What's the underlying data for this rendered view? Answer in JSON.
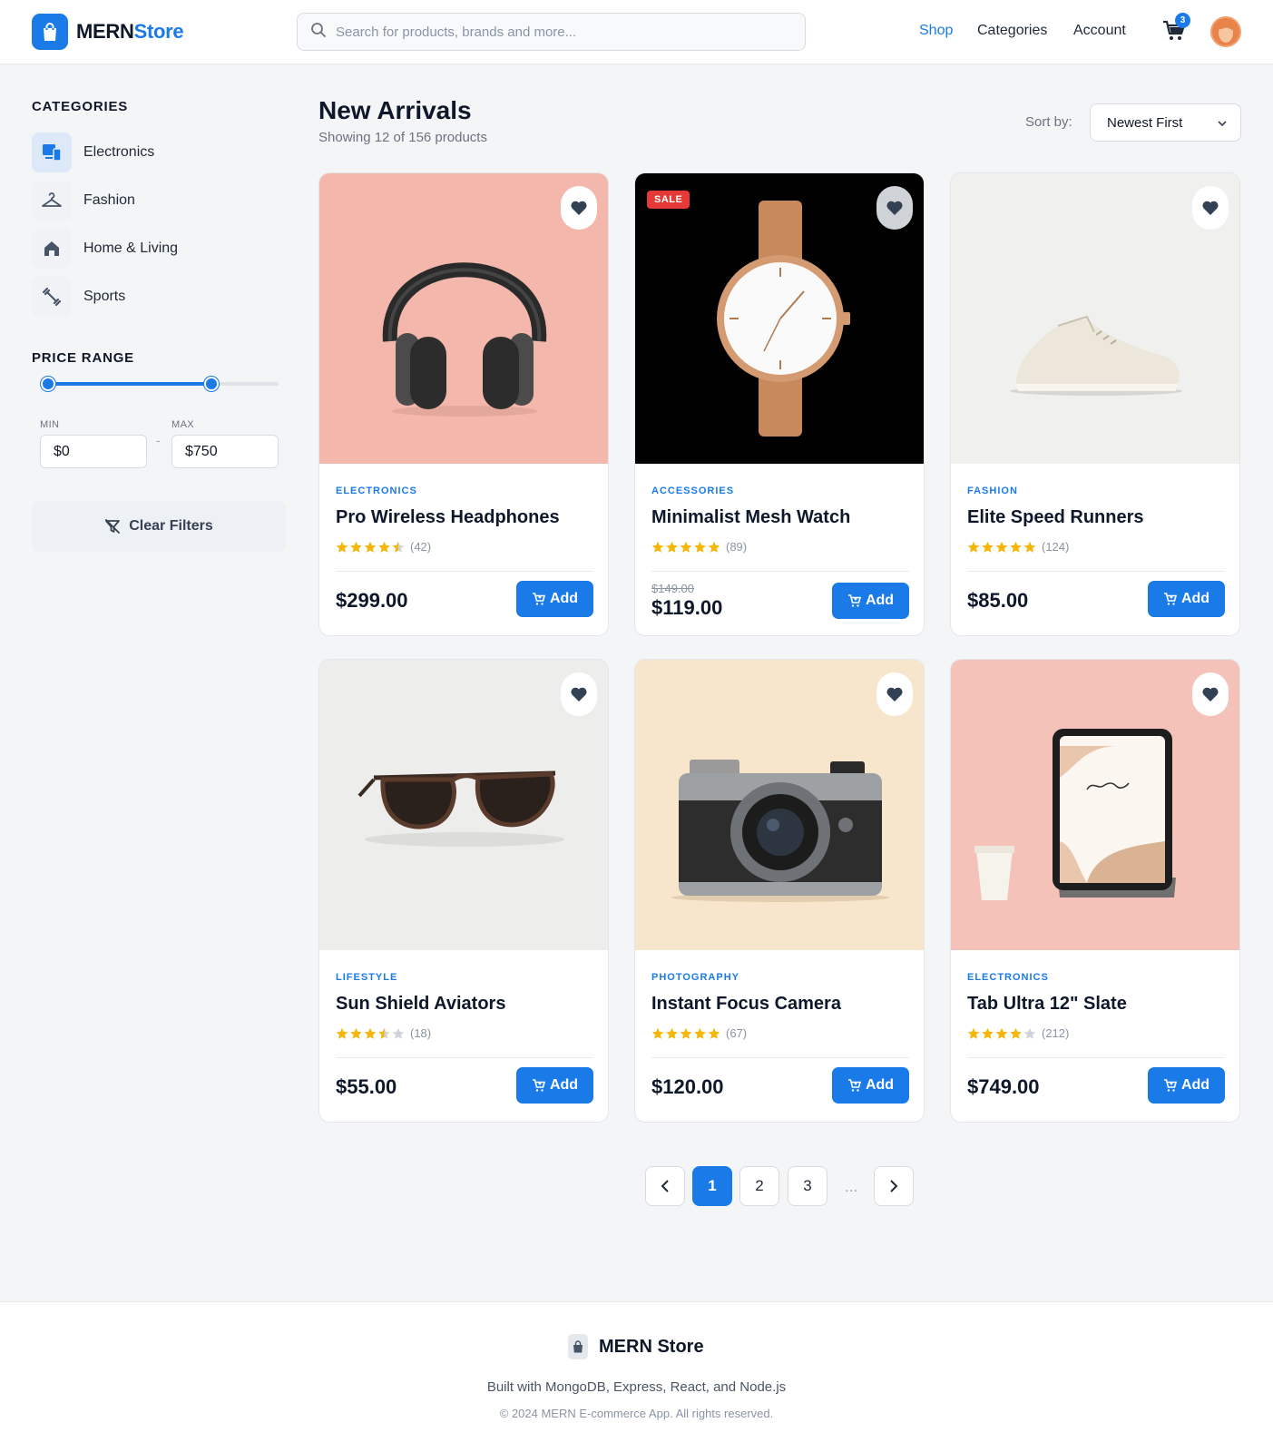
{
  "header": {
    "logo_main": "MERN",
    "logo_accent": "Store",
    "search_placeholder": "Search for products, brands and more...",
    "nav": [
      "Shop",
      "Categories",
      "Account"
    ],
    "cart_count": "3"
  },
  "sidebar": {
    "categories_title": "CATEGORIES",
    "categories": [
      {
        "label": "Electronics",
        "icon": "devices-icon"
      },
      {
        "label": "Fashion",
        "icon": "hanger-icon"
      },
      {
        "label": "Home & Living",
        "icon": "home-icon"
      },
      {
        "label": "Sports",
        "icon": "dumbbell-icon"
      }
    ],
    "price_title": "PRICE RANGE",
    "min_label": "MIN",
    "max_label": "MAX",
    "min_value": "$0",
    "max_value": "$750",
    "dash": "-",
    "clear_label": "Clear Filters"
  },
  "main": {
    "title": "New Arrivals",
    "subtitle": "Showing 12 of 156 products",
    "sort_label": "Sort by:",
    "sort_value": "Newest First"
  },
  "products": [
    {
      "category": "ELECTRONICS",
      "name": "Pro Wireless Headphones",
      "rating": 4.5,
      "reviews": "(42)",
      "price": "$299.00",
      "add": "Add"
    },
    {
      "category": "ACCESSORIES",
      "name": "Minimalist Mesh Watch",
      "rating": 5,
      "reviews": "(89)",
      "old_price": "$149.00",
      "price": "$119.00",
      "badge": "SALE",
      "add": "Add"
    },
    {
      "category": "FASHION",
      "name": "Elite Speed Runners",
      "rating": 5,
      "reviews": "(124)",
      "price": "$85.00",
      "add": "Add"
    },
    {
      "category": "LIFESTYLE",
      "name": "Sun Shield Aviators",
      "rating": 3.5,
      "reviews": "(18)",
      "price": "$55.00",
      "add": "Add"
    },
    {
      "category": "PHOTOGRAPHY",
      "name": "Instant Focus Camera",
      "rating": 5,
      "reviews": "(67)",
      "price": "$120.00",
      "add": "Add"
    },
    {
      "category": "ELECTRONICS",
      "name": "Tab Ultra 12\" Slate",
      "rating": 4,
      "reviews": "(212)",
      "price": "$749.00",
      "add": "Add"
    }
  ],
  "pagination": {
    "pages": [
      "1",
      "2",
      "3"
    ],
    "ellipsis": "...",
    "current": 1
  },
  "footer": {
    "brand": "MERN Store",
    "built": "Built with MongoDB, Express, React, and Node.js",
    "copyright": "© 2024 MERN E-commerce App. All rights reserved."
  },
  "colors": {
    "accent": "#1a7be8",
    "star": "#f5b70a",
    "sale": "#e53935"
  }
}
